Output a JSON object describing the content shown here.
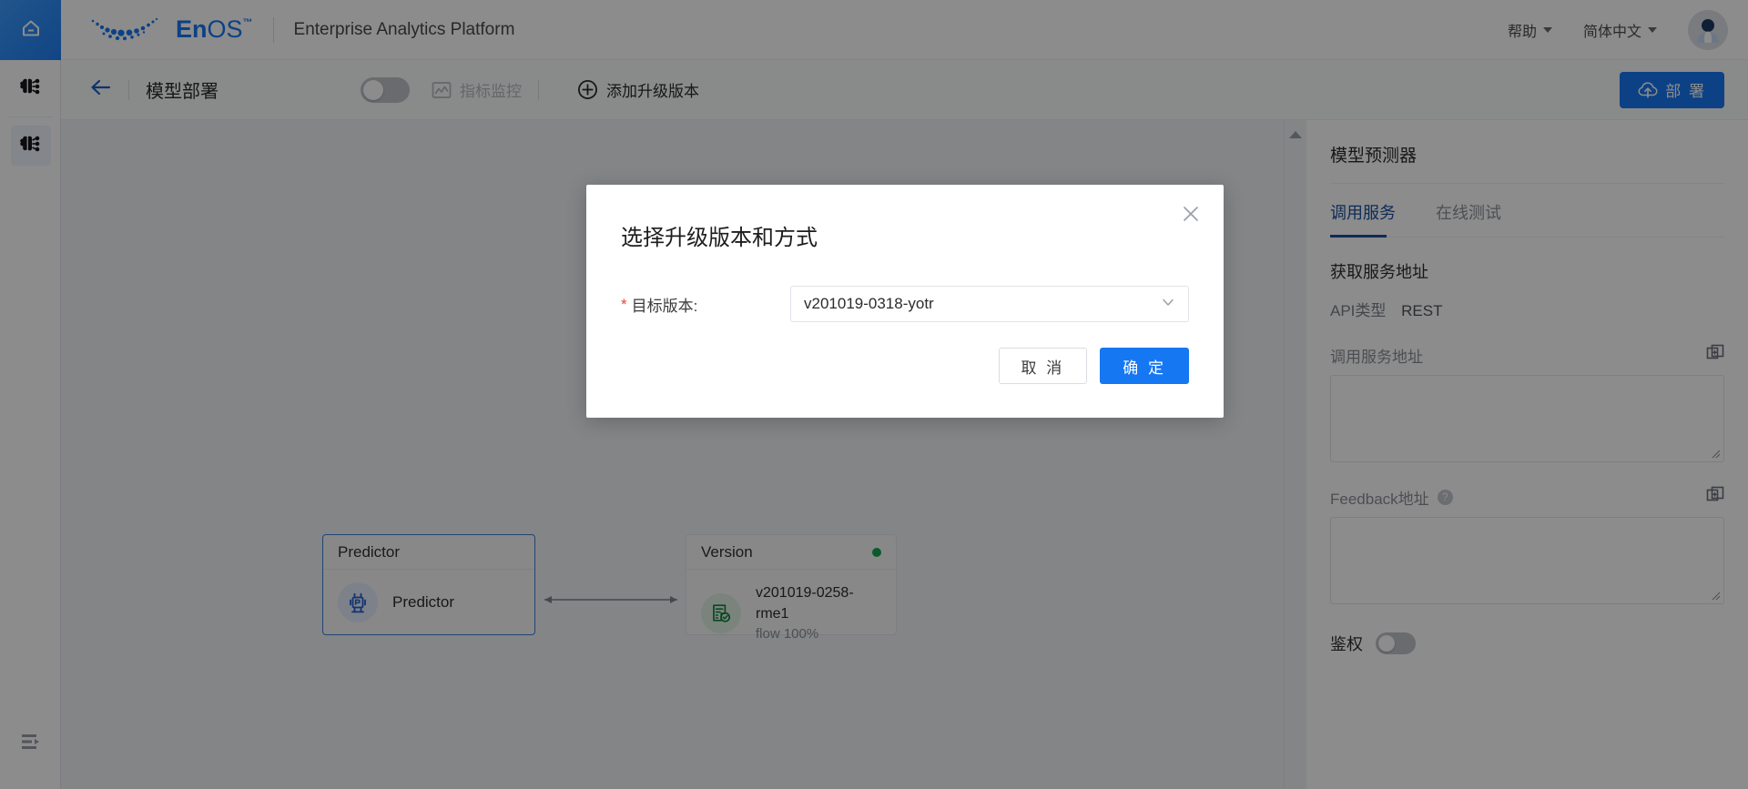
{
  "header": {
    "home_icon": "home-icon",
    "brand_mark": "enos-logo",
    "brand_en": "En",
    "brand_os": "OS",
    "brand_tm": "™",
    "subtitle": "Enterprise Analytics Platform",
    "help_label": "帮助",
    "language_label": "简体中文",
    "avatar_icon": "user-avatar"
  },
  "rail": {
    "items": [
      {
        "name": "model-lab",
        "icon": "neural-network-icon",
        "active": false
      },
      {
        "name": "model-deploy",
        "icon": "neural-network-icon",
        "active": true
      }
    ],
    "collapse_icon": "collapse-sidebar-icon"
  },
  "toolbar": {
    "back_icon": "arrow-left-icon",
    "title": "模型部署",
    "switch_on": false,
    "metric_monitor_label": "指标监控",
    "metric_monitor_icon": "chart-image-icon",
    "add_version_label": "添加升级版本",
    "add_version_icon": "plus-circle-icon",
    "deploy_label": "部 署",
    "deploy_icon": "cloud-upload-icon"
  },
  "canvas": {
    "divider_handle_icon": "triangle-up-icon",
    "nodes": [
      {
        "key": "predictor",
        "head": "Predictor",
        "icon": "predictor-icon",
        "label": "Predictor"
      },
      {
        "key": "version",
        "head": "Version",
        "icon": "version-doc-check-icon",
        "status_dot": "#13a452",
        "name": "v201019-0258-rme1",
        "flow": "flow 100%"
      }
    ],
    "edge_icon": "bidirectional-arrow"
  },
  "right_panel": {
    "title": "模型预测器",
    "tabs": [
      {
        "label": "调用服务",
        "active": true
      },
      {
        "label": "在线测试",
        "active": false
      }
    ],
    "section_title": "获取服务地址",
    "api_type_key": "API类型",
    "api_type_value": "REST",
    "service_url_label": "调用服务地址",
    "service_url_value": "",
    "service_url_copy_icon": "copy-icon",
    "feedback_label": "Feedback地址",
    "feedback_help_icon": "question-icon",
    "feedback_help_text": "?",
    "feedback_value": "",
    "feedback_copy_icon": "copy-icon",
    "auth_label": "鉴权",
    "auth_on": false
  },
  "modal": {
    "title": "选择升级版本和方式",
    "close_icon": "close-icon",
    "required_mark": "*",
    "field_label": "目标版本:",
    "field_value": "v201019-0318-yotr",
    "field_dropdown_icon": "chevron-down-icon",
    "cancel_label": "取 消",
    "confirm_label": "确 定"
  },
  "colors": {
    "accent": "#1677f2",
    "tab_active": "#1b4fa0",
    "status_green": "#13a452",
    "required_red": "#f04134",
    "canvas_bg": "#f0f2f5"
  }
}
